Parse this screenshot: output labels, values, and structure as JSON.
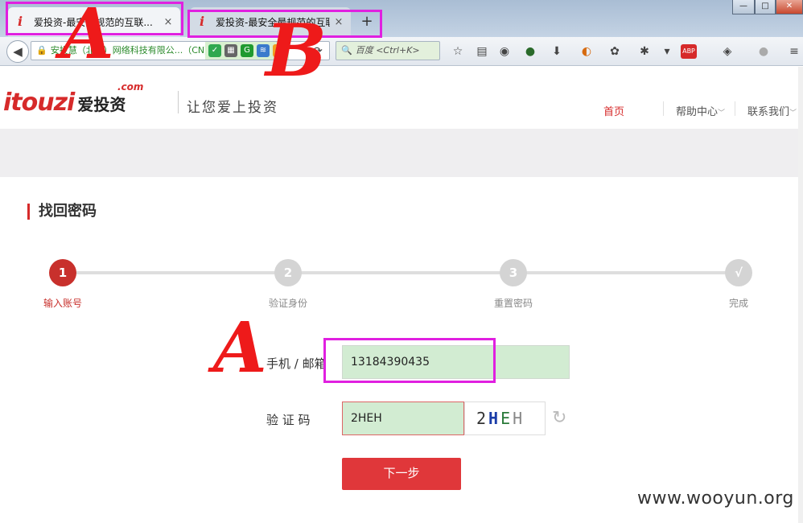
{
  "browser": {
    "tabs": [
      {
        "title": "爱投资-最安全规范的互联...",
        "close": "×"
      },
      {
        "title": "爱投资-最安全最规范的互联...",
        "close": "×"
      }
    ],
    "new_tab": "+",
    "window_controls": {
      "min": "—",
      "max": "□",
      "close": "✕"
    },
    "identity_text": "安投慧（北京）网络科技有限公...（CN）",
    "search_placeholder": "百度 <Ctrl+K>"
  },
  "site": {
    "logo_text": "itouzi",
    "logo_dotcom": ".com",
    "logo_cn": "爱投资",
    "slogan": "让您爱上投资",
    "nav": {
      "home": "首页",
      "help": "帮助中心",
      "contact": "联系我们"
    }
  },
  "page": {
    "section_title": "找回密码",
    "steps": [
      {
        "num": "1",
        "label": "输入账号"
      },
      {
        "num": "2",
        "label": "验证身份"
      },
      {
        "num": "3",
        "label": "重置密码"
      },
      {
        "num": "√",
        "label": "完成"
      }
    ],
    "current_step": 1,
    "form": {
      "account_label": "手机 / 邮箱",
      "account_value": "13184390435",
      "captcha_label": "验 证 码",
      "captcha_value": "2HEH",
      "captcha_image": [
        "2",
        "H",
        "E",
        "H"
      ],
      "next_button": "下一步"
    }
  },
  "annotations": {
    "tab_a": "A",
    "tab_b": "B",
    "field_a": "A",
    "color": "#ee1a1a",
    "box_color": "#e020e0"
  },
  "watermark": "www.wooyun.org"
}
